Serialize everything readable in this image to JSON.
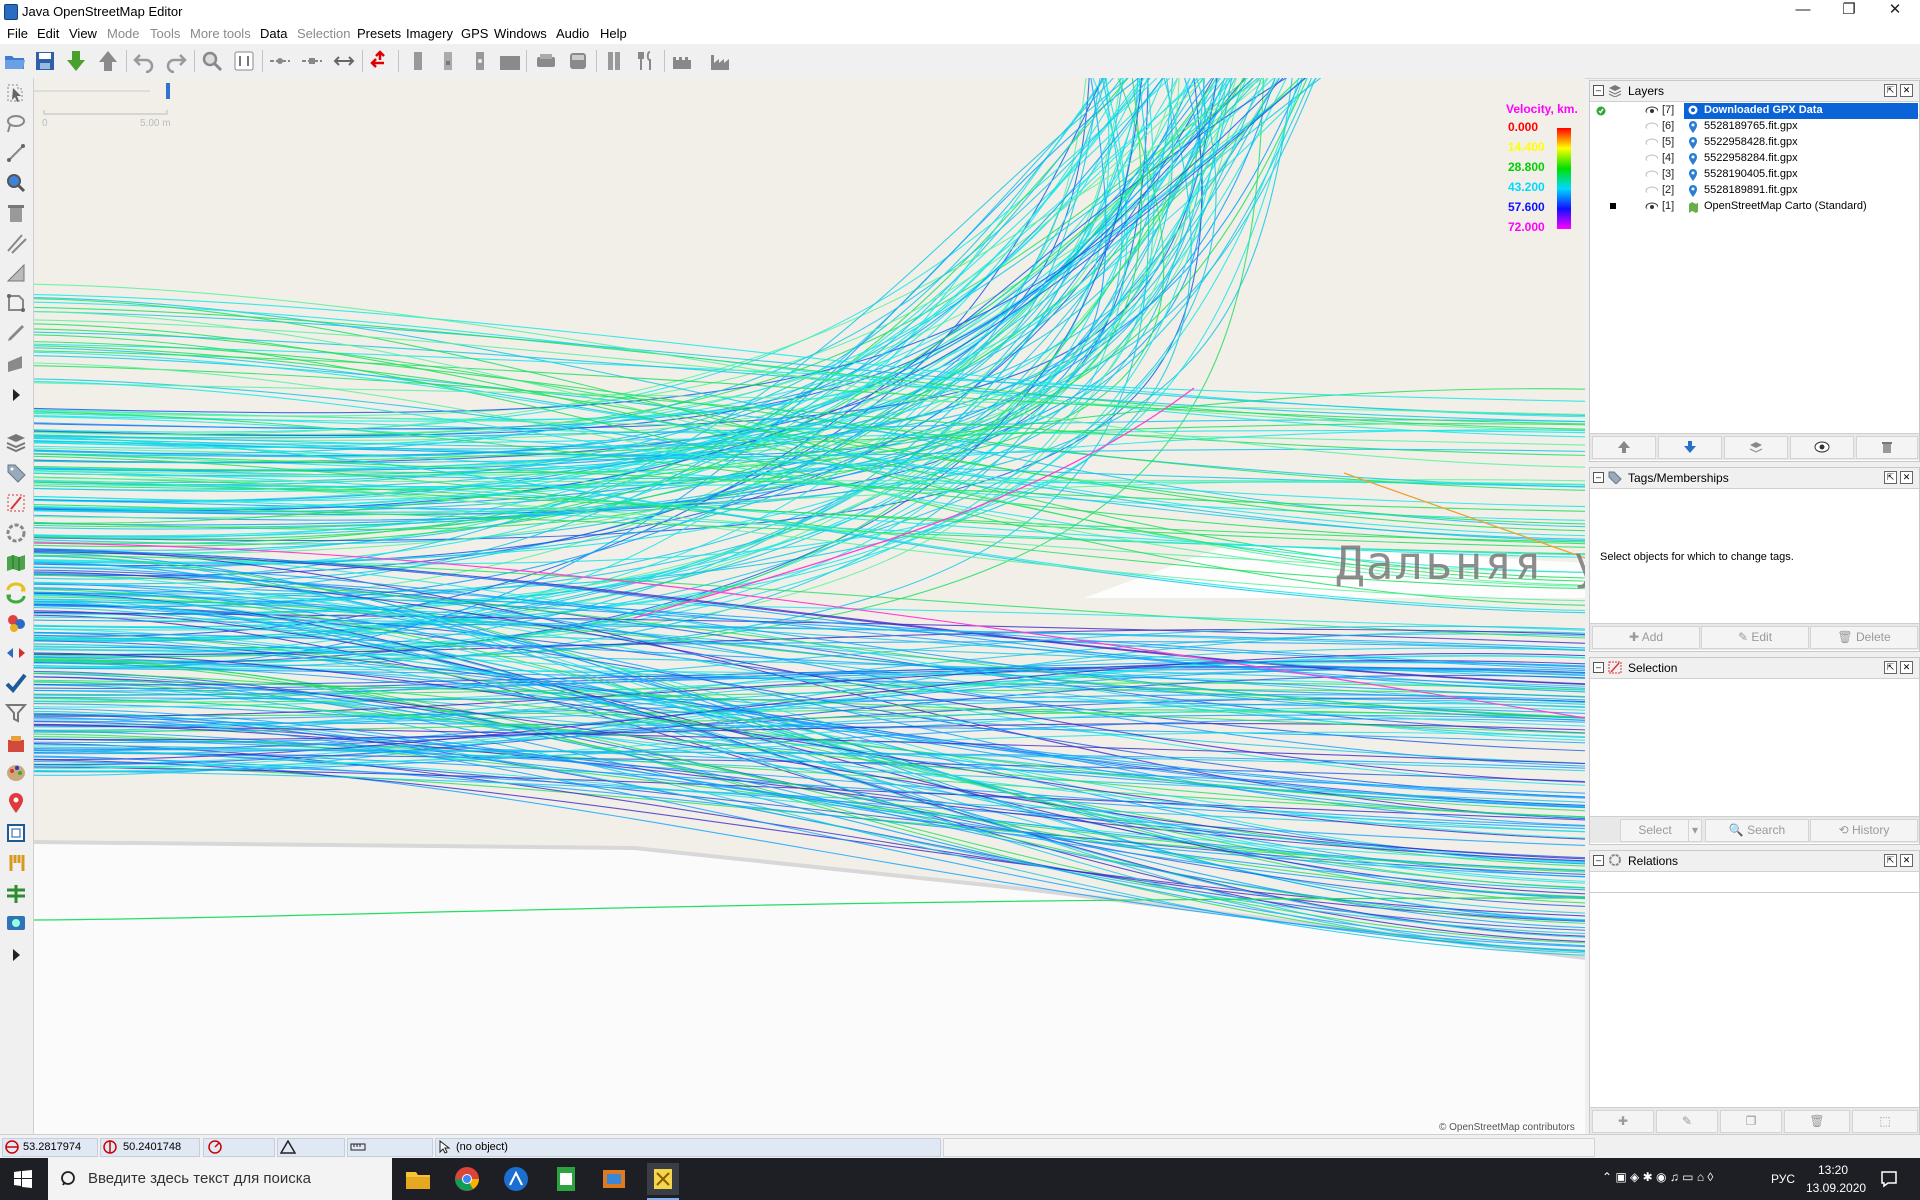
{
  "window": {
    "title": "Java OpenStreetMap Editor",
    "controls": {
      "minimize": "—",
      "maximize": "❐",
      "close": "✕"
    }
  },
  "menu": [
    {
      "label": "File",
      "enabled": true
    },
    {
      "label": "Edit",
      "enabled": true
    },
    {
      "label": "View",
      "enabled": true
    },
    {
      "label": "Mode",
      "enabled": false
    },
    {
      "label": "Tools",
      "enabled": false
    },
    {
      "label": "More tools",
      "enabled": false
    },
    {
      "label": "Data",
      "enabled": true
    },
    {
      "label": "Selection",
      "enabled": false
    },
    {
      "label": "Presets",
      "enabled": true
    },
    {
      "label": "Imagery",
      "enabled": true
    },
    {
      "label": "GPS",
      "enabled": true
    },
    {
      "label": "Windows",
      "enabled": true
    },
    {
      "label": "Audio",
      "enabled": true
    },
    {
      "label": "Help",
      "enabled": true
    }
  ],
  "map": {
    "scale_label": "5.00 m",
    "scale_zero": "0",
    "street_label": "Дальняя у",
    "attribution": "© OpenStreetMap contributors",
    "legend": {
      "title": "Velocity, km.",
      "values": [
        "0.000",
        "14.400",
        "28.800",
        "43.200",
        "57.600",
        "72.000"
      ],
      "colors": [
        "#ff0000",
        "#ffff00",
        "#00e000",
        "#00d8ff",
        "#1010ff",
        "#ff00ff"
      ]
    },
    "track_colors": [
      "#19e6e6",
      "#14c8e6",
      "#0aa0ff",
      "#1e5ae6",
      "#20e060",
      "#5af0a0",
      "#3c28c8",
      "#ff40d0",
      "#f0a030"
    ]
  },
  "layers_panel": {
    "title": "Layers",
    "layers": [
      {
        "num": "[7]",
        "name": "Downloaded GPX Data",
        "visible": true,
        "selected": true
      },
      {
        "num": "[6]",
        "name": "5528189765.fit.gpx",
        "visible": false,
        "selected": false
      },
      {
        "num": "[5]",
        "name": "5522958428.fit.gpx",
        "visible": false,
        "selected": false
      },
      {
        "num": "[4]",
        "name": "5522958284.fit.gpx",
        "visible": false,
        "selected": false
      },
      {
        "num": "[3]",
        "name": "5528190405.fit.gpx",
        "visible": false,
        "selected": false
      },
      {
        "num": "[2]",
        "name": "5528189891.fit.gpx",
        "visible": false,
        "selected": false
      },
      {
        "num": "[1]",
        "name": "OpenStreetMap Carto (Standard)",
        "visible": true,
        "selected": false
      }
    ]
  },
  "tags_panel": {
    "title": "Tags/Memberships",
    "message": "Select objects for which to change tags.",
    "buttons": {
      "add": "Add",
      "edit": "Edit",
      "delete": "Delete"
    }
  },
  "selection_panel": {
    "title": "Selection",
    "buttons": {
      "select": "Select",
      "search": "Search",
      "history": "History"
    }
  },
  "relations_panel": {
    "title": "Relations"
  },
  "status": {
    "lat": "53.2817974",
    "lon": "50.2401748",
    "object": "(no object)"
  },
  "taskbar": {
    "search_placeholder": "Введите здесь текст для поиска",
    "lang": "РУС",
    "time": "13:20",
    "date": "13.09.2020"
  }
}
